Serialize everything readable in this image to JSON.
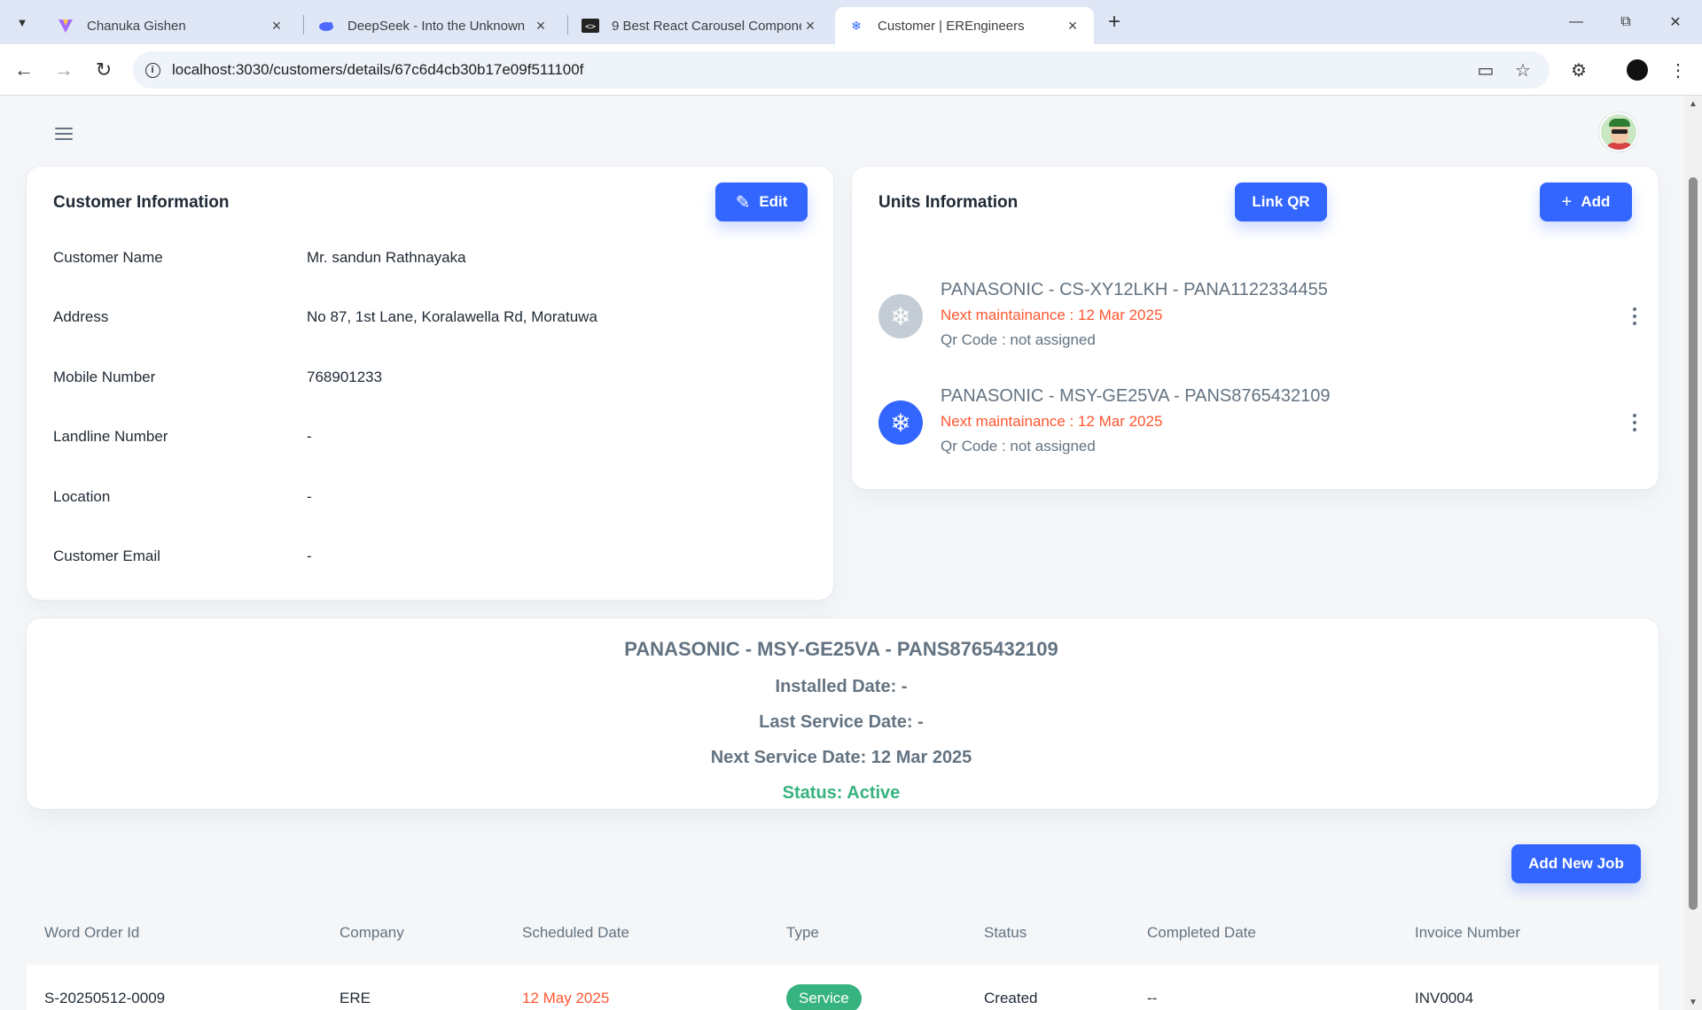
{
  "browser": {
    "tabs": [
      {
        "title": "Chanuka Gishen"
      },
      {
        "title": "DeepSeek - Into the Unknown"
      },
      {
        "title": "9 Best React Carousel Compone"
      },
      {
        "title": "Customer | EREngineers"
      }
    ],
    "url": "localhost:3030/customers/details/67c6d4cb30b17e09f511100f"
  },
  "customer_info": {
    "title": "Customer Information",
    "edit_label": "Edit",
    "rows": [
      {
        "label": "Customer Name",
        "value": "Mr. sandun Rathnayaka"
      },
      {
        "label": "Address",
        "value": "No 87, 1st Lane, Koralawella Rd, Moratuwa"
      },
      {
        "label": "Mobile Number",
        "value": "768901233"
      },
      {
        "label": "Landline Number",
        "value": "-"
      },
      {
        "label": "Location",
        "value": "-"
      },
      {
        "label": "Customer Email",
        "value": "-"
      }
    ]
  },
  "units_info": {
    "title": "Units Information",
    "link_qr_label": "Link QR",
    "add_label": "Add",
    "units": [
      {
        "name": "PANASONIC - CS-XY12LKH - PANA1122334455",
        "next": "Next maintainance : 12 Mar 2025",
        "qr": "Qr Code : not assigned",
        "selected": false
      },
      {
        "name": "PANASONIC - MSY-GE25VA - PANS8765432109",
        "next": "Next maintainance : 12 Mar 2025",
        "qr": "Qr Code : not assigned",
        "selected": true
      }
    ]
  },
  "unit_detail": {
    "title": "PANASONIC - MSY-GE25VA - PANS8765432109",
    "installed": "Installed Date: -",
    "last_service": "Last Service Date: -",
    "next_service": "Next Service Date: 12 Mar 2025",
    "status": "Status: Active"
  },
  "jobs": {
    "add_label": "Add New Job",
    "columns": [
      "Word Order Id",
      "Company",
      "Scheduled Date",
      "Type",
      "Status",
      "Completed Date",
      "Invoice Number"
    ],
    "rows": [
      {
        "id": "S-20250512-0009",
        "company": "ERE",
        "scheduled": "12 May 2025",
        "type": "Service",
        "status": "Created",
        "completed": "--",
        "invoice": "INV0004"
      }
    ]
  },
  "colors": {
    "primary": "#3366ff",
    "error": "#ff5630",
    "success": "#36b37e",
    "muted": "#637381",
    "unit_icon_inactive": "#c4cdd5"
  }
}
